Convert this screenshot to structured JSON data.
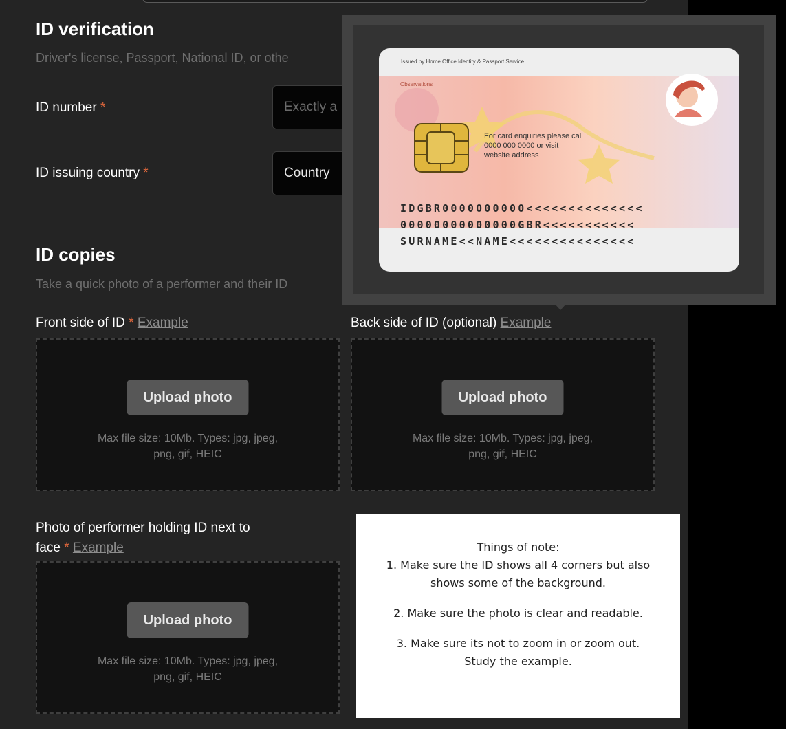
{
  "id_verification": {
    "title": "ID verification",
    "description": "Driver's license, Passport, National ID, or othe",
    "id_number": {
      "label": "ID number",
      "required_mark": "*",
      "placeholder": "Exactly a"
    },
    "issuing_country": {
      "label": "ID issuing country",
      "required_mark": "*",
      "value": "Country"
    }
  },
  "id_copies": {
    "title": "ID copies",
    "description": "Take a quick photo of a performer and their ID",
    "front": {
      "label": "Front side of ID",
      "required_mark": "*",
      "example_link": "Example"
    },
    "back": {
      "label": "Back side of ID (optional)",
      "example_link": "Example"
    },
    "face": {
      "label_line1": "Photo of performer holding ID next to",
      "label_line2": "face",
      "required_mark": "*",
      "example_link": "Example"
    },
    "upload_button": "Upload photo",
    "hint_line1": "Max file size: 10Mb. Types: jpg, jpeg,",
    "hint_line2": "png, gif, HEIC"
  },
  "example_card": {
    "issued_by": "Issued by Home Office Identity & Passport Service.",
    "observations": "Observations",
    "enquiry_lines": [
      "For card enquiries please call",
      "0000 000 0000 or visit",
      "website address"
    ],
    "mrz_lines": [
      "IDGBR0000000000<<<<<<<<<<<<<<",
      "00000000000000GBR<<<<<<<<<<<",
      "SURNAME<<NAME<<<<<<<<<<<<<<<"
    ]
  },
  "note": {
    "heading": "Things of note:",
    "items": [
      "1. Make sure the ID shows all 4 corners but also",
      "shows some of the background.",
      "2. Make sure the photo is clear and readable.",
      "3. Make sure its not to zoom in or zoom out.",
      "Study the example."
    ]
  },
  "colors": {
    "panel": "#242424",
    "required": "#e0673c",
    "button": "#575757"
  }
}
